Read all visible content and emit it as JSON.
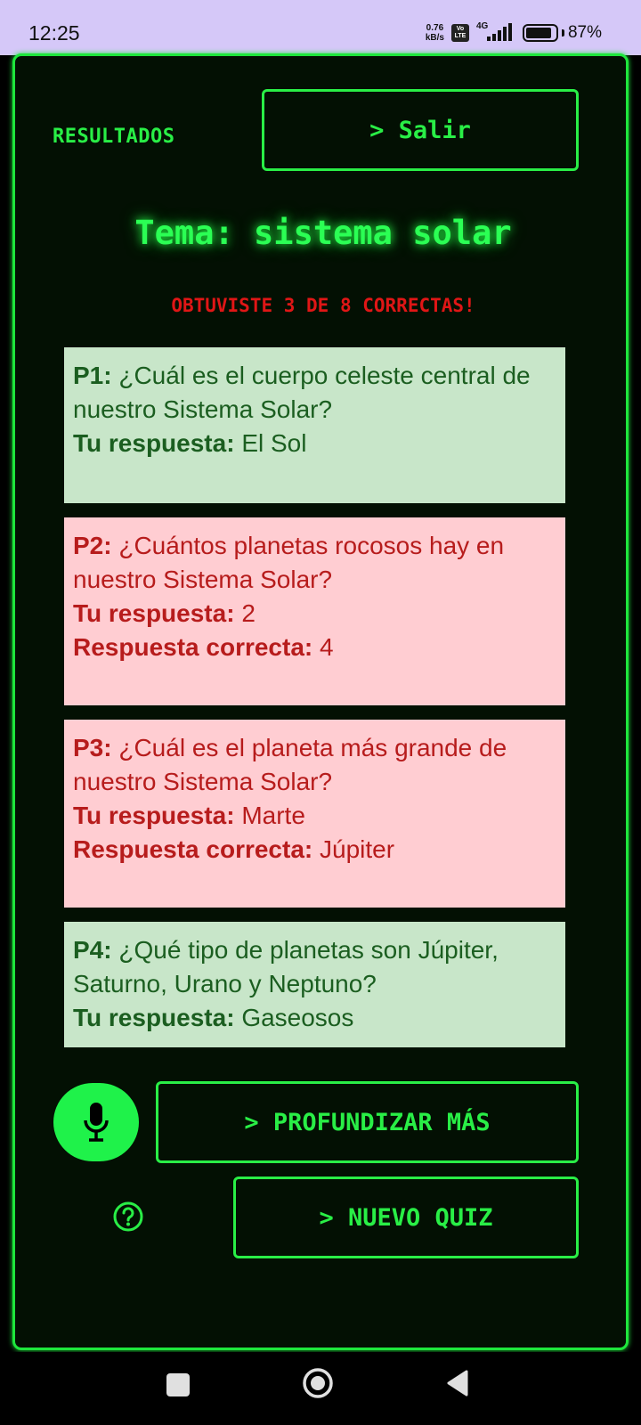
{
  "status_bar": {
    "time": "12:25",
    "net_speed_value": "0.76",
    "net_speed_unit": "kB/s",
    "volte_top": "Vo",
    "volte_bottom": "LTE",
    "network": "4G",
    "battery": "87%",
    "battery_level": 0.87
  },
  "header": {
    "title": "RESULTADOS",
    "exit_label": "> Salir"
  },
  "topic": "Tema: sistema solar",
  "score": "OBTUVISTE 3 DE 8 CORRECTAS!",
  "questions": [
    {
      "status": "correct",
      "number": "P1:",
      "question": "¿Cuál es el cuerpo celeste central de nuestro Sistema Solar?",
      "answer_label": "Tu respuesta:",
      "answer": "El Sol",
      "correct_label": "",
      "correct_answer": ""
    },
    {
      "status": "wrong",
      "number": "P2:",
      "question": "¿Cuántos planetas rocosos hay en nuestro Sistema Solar?",
      "answer_label": "Tu respuesta:",
      "answer": "2",
      "correct_label": "Respuesta correcta:",
      "correct_answer": "4"
    },
    {
      "status": "wrong",
      "number": "P3:",
      "question": "¿Cuál es el planeta más grande de nuestro Sistema Solar?",
      "answer_label": "Tu respuesta:",
      "answer": "Marte",
      "correct_label": "Respuesta correcta:",
      "correct_answer": "Júpiter"
    },
    {
      "status": "correct",
      "number": "P4:",
      "question": "¿Qué tipo de planetas son Júpiter, Saturno, Urano y Neptuno?",
      "answer_label": "Tu respuesta:",
      "answer": "Gaseosos",
      "correct_label": "",
      "correct_answer": ""
    }
  ],
  "actions": {
    "deeper_label": "> PROFUNDIZAR MÁS",
    "new_quiz_label": "> NUEVO QUIZ",
    "mic_icon": "microphone-icon",
    "help_icon": "help-circle-icon"
  },
  "colors": {
    "accent": "#29ee46",
    "background": "#031003",
    "error_text": "#e01616",
    "correct_bg": "#c8e6c9",
    "correct_text": "#1b5e20",
    "wrong_bg": "#ffcdd2",
    "wrong_text": "#b71c1c"
  }
}
